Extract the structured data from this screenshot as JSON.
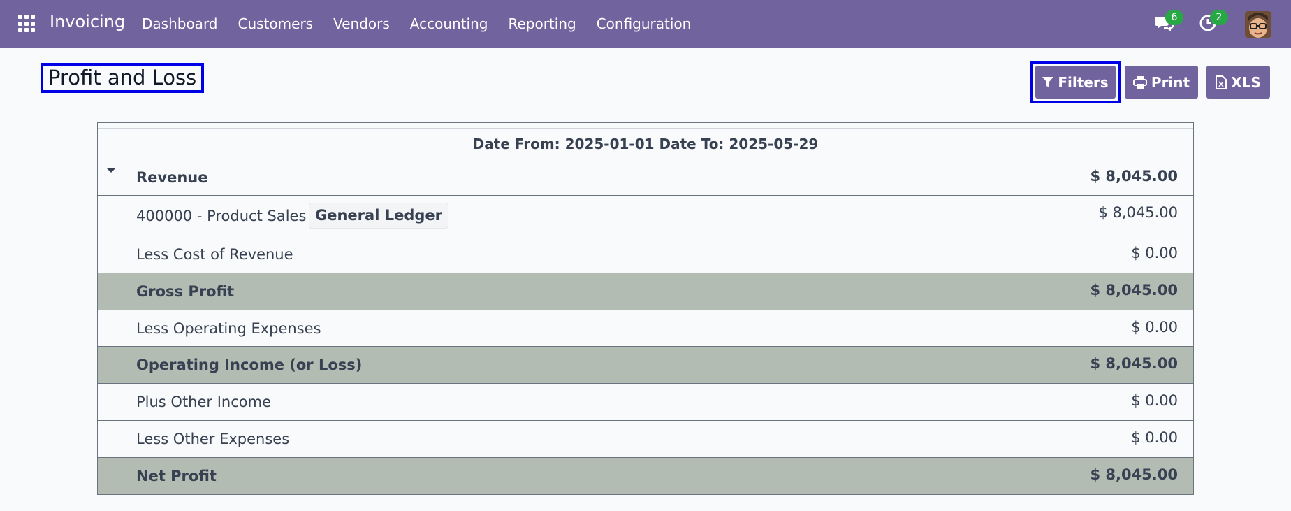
{
  "navbar": {
    "app_name": "Invoicing",
    "menu": [
      "Dashboard",
      "Customers",
      "Vendors",
      "Accounting",
      "Reporting",
      "Configuration"
    ],
    "messages_badge": "6",
    "activities_badge": "2"
  },
  "page": {
    "title": "Profit and Loss",
    "buttons": {
      "filters": "Filters",
      "print": "Print",
      "xls": "XLS"
    }
  },
  "report": {
    "date_range": "Date From: 2025-01-01 Date To: 2025-05-29",
    "rows": [
      {
        "label": "Revenue",
        "amount": "$ 8,045.00"
      },
      {
        "label": "400000 - Product Sales",
        "amount": "$ 8,045.00",
        "link": "General Ledger"
      },
      {
        "label": "Less Cost of Revenue",
        "amount": "$ 0.00"
      },
      {
        "label": "Gross Profit",
        "amount": "$ 8,045.00"
      },
      {
        "label": "Less Operating Expenses",
        "amount": "$ 0.00"
      },
      {
        "label": "Operating Income (or Loss)",
        "amount": "$ 8,045.00"
      },
      {
        "label": "Plus Other Income",
        "amount": "$ 0.00"
      },
      {
        "label": "Less Other Expenses",
        "amount": "$ 0.00"
      },
      {
        "label": "Net Profit",
        "amount": "$ 8,045.00"
      }
    ]
  },
  "colors": {
    "brand": "#71639e",
    "highlight_box": "#0000e6",
    "subtotal_row": "#b3bcb3",
    "badge": "#28a745"
  }
}
